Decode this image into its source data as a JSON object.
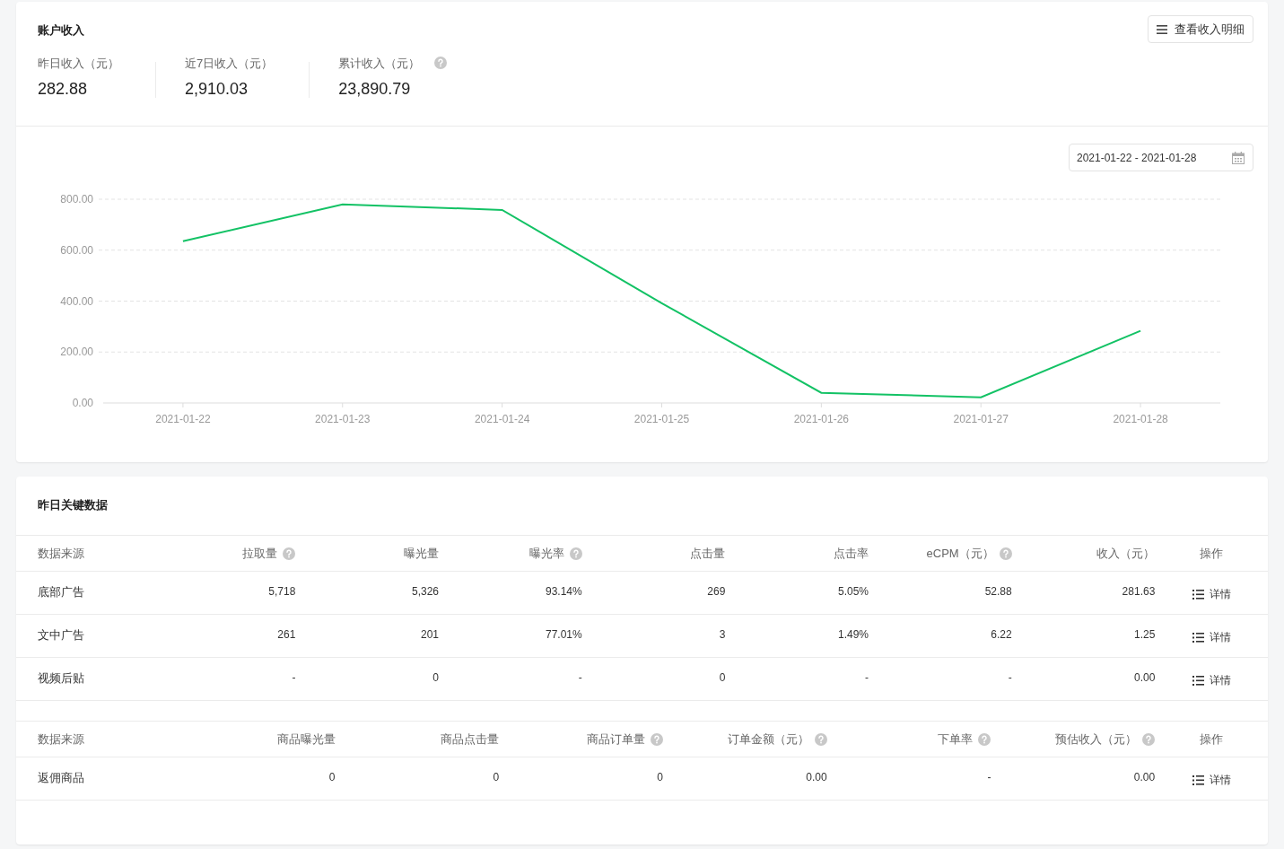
{
  "summary": {
    "title": "账户收入",
    "detail_button": "查看收入明细",
    "stats": [
      {
        "label": "昨日收入（元）",
        "value": "282.88",
        "help": false
      },
      {
        "label": "近7日收入（元）",
        "value": "2,910.03",
        "help": false
      },
      {
        "label": "累计收入（元）",
        "value": "23,890.79",
        "help": true
      }
    ]
  },
  "date_range": "2021-01-22 - 2021-01-28",
  "chart_data": {
    "type": "line",
    "categories": [
      "2021-01-22",
      "2021-01-23",
      "2021-01-24",
      "2021-01-25",
      "2021-01-26",
      "2021-01-27",
      "2021-01-28"
    ],
    "grid": true,
    "series": [
      {
        "color": "#13c265",
        "values": [
          635,
          780,
          758,
          392,
          40,
          22,
          283
        ]
      }
    ],
    "ylim": [
      0,
      800
    ],
    "yticks": [
      {
        "value": 0,
        "label": "0.00"
      },
      {
        "value": 200,
        "label": "200.00"
      },
      {
        "value": 400,
        "label": "400.00"
      },
      {
        "value": 600,
        "label": "600.00"
      },
      {
        "value": 800,
        "label": "800.00"
      }
    ]
  },
  "key_data": {
    "title": "昨日关键数据",
    "tables": [
      {
        "columns": [
          {
            "label": "数据来源",
            "help": false
          },
          {
            "label": "拉取量",
            "help": true
          },
          {
            "label": "曝光量",
            "help": false
          },
          {
            "label": "曝光率",
            "help": true
          },
          {
            "label": "点击量",
            "help": false
          },
          {
            "label": "点击率",
            "help": false
          },
          {
            "label": "eCPM（元）",
            "help": true
          },
          {
            "label": "收入（元）",
            "help": false
          },
          {
            "label": "操作",
            "help": false
          }
        ],
        "rows": [
          {
            "cells": [
              "底部广告",
              "5,718",
              "5,326",
              "93.14%",
              "269",
              "5.05%",
              "52.88",
              "281.63"
            ],
            "action": "详情"
          },
          {
            "cells": [
              "文中广告",
              "261",
              "201",
              "77.01%",
              "3",
              "1.49%",
              "6.22",
              "1.25"
            ],
            "action": "详情"
          },
          {
            "cells": [
              "视频后贴",
              "-",
              "0",
              "-",
              "0",
              "-",
              "-",
              "0.00"
            ],
            "action": "详情"
          }
        ]
      },
      {
        "columns": [
          {
            "label": "数据来源",
            "help": false
          },
          {
            "label": "商品曝光量",
            "help": false
          },
          {
            "label": "商品点击量",
            "help": false
          },
          {
            "label": "商品订单量",
            "help": true
          },
          {
            "label": "订单金额（元）",
            "help": true
          },
          {
            "label": "下单率",
            "help": true
          },
          {
            "label": "预估收入（元）",
            "help": true
          },
          {
            "label": "操作",
            "help": false
          }
        ],
        "rows": [
          {
            "cells": [
              "返佣商品",
              "0",
              "0",
              "0",
              "0.00",
              "-",
              "0.00"
            ],
            "action": "详情"
          }
        ]
      }
    ]
  }
}
